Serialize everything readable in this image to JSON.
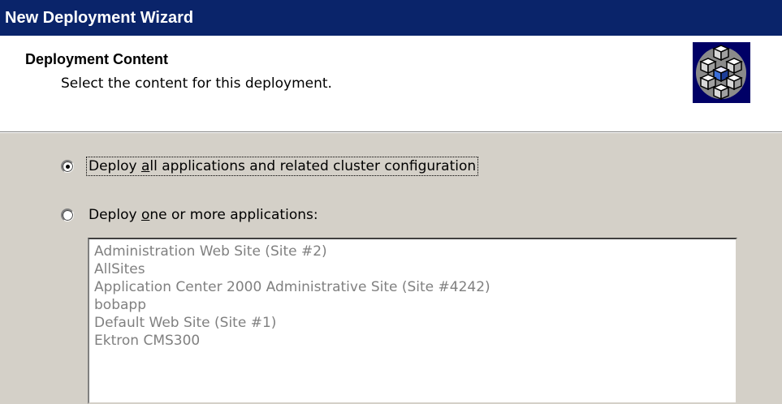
{
  "window": {
    "title": "New Deployment Wizard"
  },
  "header": {
    "title": "Deployment Content",
    "subtitle": "Select the content for this deployment.",
    "icon": "deployment-cubes-icon"
  },
  "options": [
    {
      "label_pre": "Deploy ",
      "label_accel": "a",
      "label_post": "ll applications and related cluster configuration",
      "checked": true
    },
    {
      "label_pre": "Deploy ",
      "label_accel": "o",
      "label_post": "ne or more applications:",
      "checked": false
    }
  ],
  "applications": {
    "enabled": false,
    "items": [
      "Administration Web Site (Site #2)",
      "AllSites",
      "Application Center 2000 Administrative Site (Site #4242)",
      "bobapp",
      "Default Web Site (Site #1)",
      "Ektron CMS300"
    ]
  },
  "colors": {
    "title_bar": "#0a246a",
    "dialog_face": "#d4d0c8",
    "disabled_text": "#808080"
  }
}
